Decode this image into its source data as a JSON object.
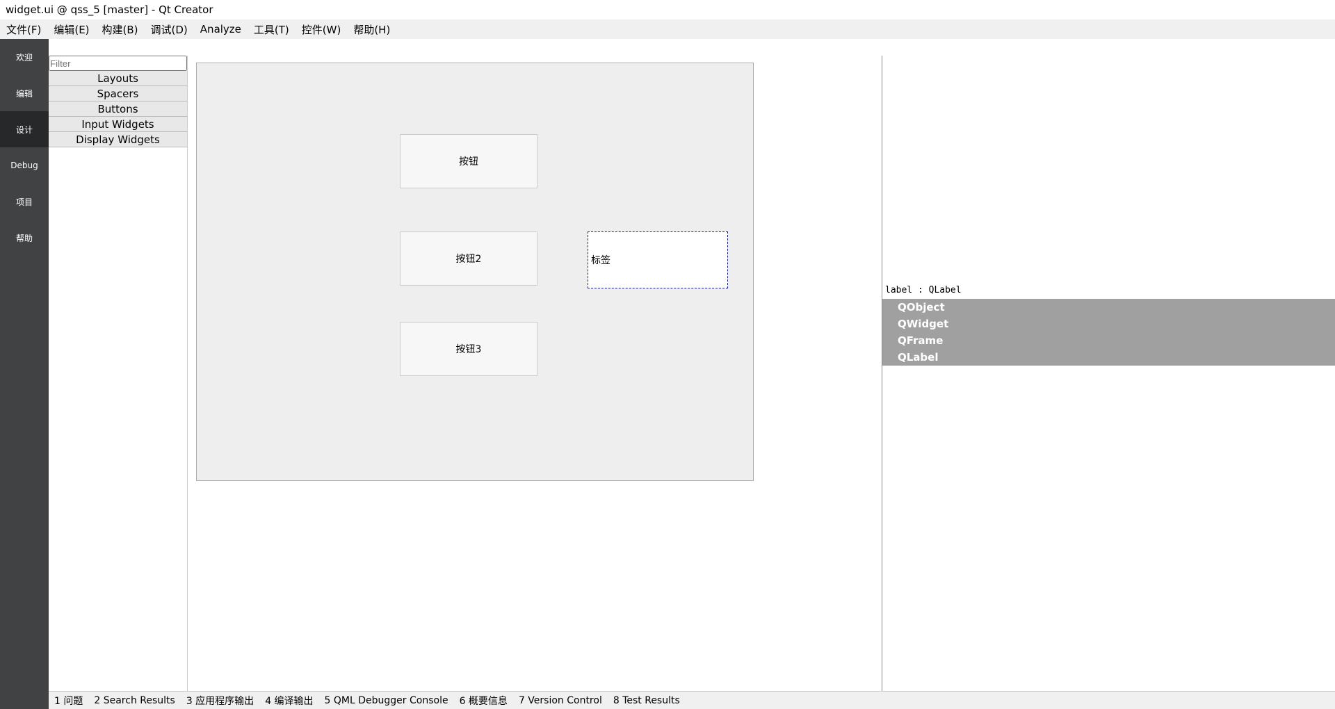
{
  "window": {
    "title": "widget.ui @ qss_5 [master] - Qt Creator"
  },
  "menu": [
    "文件(F)",
    "编辑(E)",
    "构建(B)",
    "调试(D)",
    "Analyze",
    "工具(T)",
    "控件(W)",
    "帮助(H)"
  ],
  "modes": [
    "欢迎",
    "编辑",
    "设计",
    "Debug",
    "项目",
    "帮助"
  ],
  "widgetbox": {
    "filter_placeholder": "Filter",
    "categories": [
      "Layouts",
      "Spacers",
      "Buttons",
      "Input Widgets",
      "Display Widgets"
    ]
  },
  "form": {
    "button1": "按钮",
    "button2": "按钮2",
    "button3": "按钮3",
    "label": "标签"
  },
  "properties": {
    "current_object": "label : QLabel",
    "groups": [
      "QObject",
      "QWidget",
      "QFrame",
      "QLabel"
    ]
  },
  "statusbar": [
    "1 问题",
    "2 Search Results",
    "3 应用程序输出",
    "4 编译输出",
    "5 QML Debugger Console",
    "6 概要信息",
    "7 Version Control",
    "8 Test Results"
  ]
}
